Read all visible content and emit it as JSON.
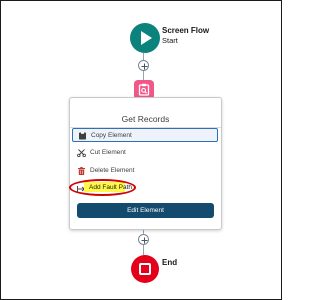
{
  "start_node": {
    "title": "Screen Flow",
    "subtitle": "Start",
    "color": "#0b827c",
    "icon": "play-icon"
  },
  "get_records_node": {
    "color": "#f2578a",
    "icon": "get-records-icon"
  },
  "panel": {
    "title": "Get Records",
    "menu": [
      {
        "label": "Copy Element",
        "icon": "copy-icon"
      },
      {
        "label": "Cut Element",
        "icon": "scissors-icon"
      },
      {
        "label": "Delete Element",
        "icon": "trash-icon"
      },
      {
        "label": "Add Fault Path",
        "icon": "fault-path-icon",
        "highlighted": true
      }
    ],
    "edit_button": "Edit Element"
  },
  "end_node": {
    "title": "End",
    "color": "#e4001b",
    "icon": "stop-icon"
  },
  "colors": {
    "accent": "#134b6f",
    "highlight": "#fff84a",
    "annotation": "#d00000"
  }
}
